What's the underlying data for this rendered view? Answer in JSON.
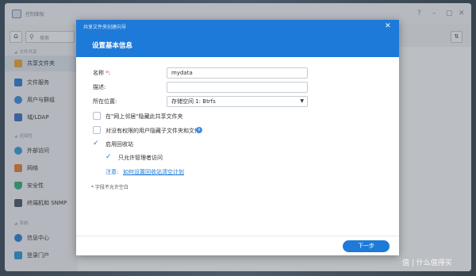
{
  "app": {
    "title": "控制面板"
  },
  "toolbar": {
    "search_placeholder": "搜索"
  },
  "sidebar": {
    "sections": [
      {
        "label": "文件共享",
        "items": [
          {
            "label": "共享文件夹",
            "icon": "folder-icon",
            "color": "#f0a92e",
            "active": true
          },
          {
            "label": "文件服务",
            "icon": "file-services-icon",
            "color": "#2f7fd6",
            "active": false
          },
          {
            "label": "用户与群组",
            "icon": "users-icon",
            "color": "#3a8ee0",
            "active": false
          },
          {
            "label": "域/LDAP",
            "icon": "domain-icon",
            "color": "#3b72c4",
            "active": false
          }
        ]
      },
      {
        "label": "连接性",
        "items": [
          {
            "label": "外部访问",
            "icon": "globe-icon",
            "color": "#35a2d9",
            "active": false
          },
          {
            "label": "网络",
            "icon": "network-icon",
            "color": "#e8803a",
            "active": false
          },
          {
            "label": "安全性",
            "icon": "shield-icon",
            "color": "#36b07a",
            "active": false
          },
          {
            "label": "终端机和 SNMP",
            "icon": "terminal-icon",
            "color": "#4d5866",
            "active": false
          }
        ]
      },
      {
        "label": "系统",
        "items": [
          {
            "label": "信息中心",
            "icon": "info-center-icon",
            "color": "#2f7fd6",
            "active": false
          },
          {
            "label": "登录门户",
            "icon": "login-portal-icon",
            "color": "#2a9bd6",
            "active": false
          }
        ]
      }
    ]
  },
  "dialog": {
    "title": "共享文件夹创建向导",
    "subtitle": "设置基本信息",
    "name_label": "名称",
    "name_req": "*",
    "name_colon": ":",
    "name_value": "mydata",
    "desc_label": "描述:",
    "desc_value": "",
    "location_label": "所在位置:",
    "location_value": "存储空间 1:  Btrfs",
    "checkboxes": [
      {
        "label": "在\"网上邻居\"隐藏此共享文件夹",
        "checked": false
      },
      {
        "label": "对没有权限的用户隐藏子文件夹和文件",
        "checked": false
      },
      {
        "label": "启用回收站",
        "checked": true
      },
      {
        "label": "只允许管理者访问",
        "checked": true
      }
    ],
    "note_label": "注意:",
    "note_link": "如何设置回收站清空计划",
    "required_note": "* 字段不允许空白",
    "next_button": "下一步"
  },
  "watermark": "值 | 什么值得买",
  "accent_color": "#1e7ad8"
}
